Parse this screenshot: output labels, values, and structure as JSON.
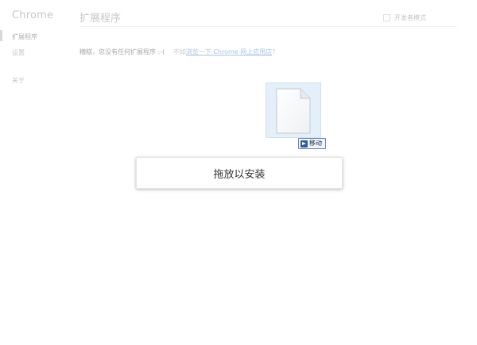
{
  "sidebar": {
    "brand": "Chrome",
    "items": [
      {
        "label": "扩展程序"
      },
      {
        "label": "设置"
      },
      {
        "label": "关于"
      }
    ]
  },
  "header": {
    "title": "扩展程序",
    "developer_mode": {
      "label": "开发者模式",
      "checked": false
    }
  },
  "empty_state": {
    "message": "糟糕，您没有任何扩展程序 :-(",
    "prefix": "不如",
    "link": "浏览一下 Chrome 网上应用店",
    "suffix": "？"
  },
  "drag": {
    "badge_label": "移动",
    "drop_label": "拖放以安装"
  },
  "colors": {
    "drop_shadow": "#999999",
    "link": "#a9c4e4",
    "badge_border": "#6a86b4"
  },
  "icons": {
    "file": "blank-file-icon",
    "move": "move-arrow-icon"
  }
}
